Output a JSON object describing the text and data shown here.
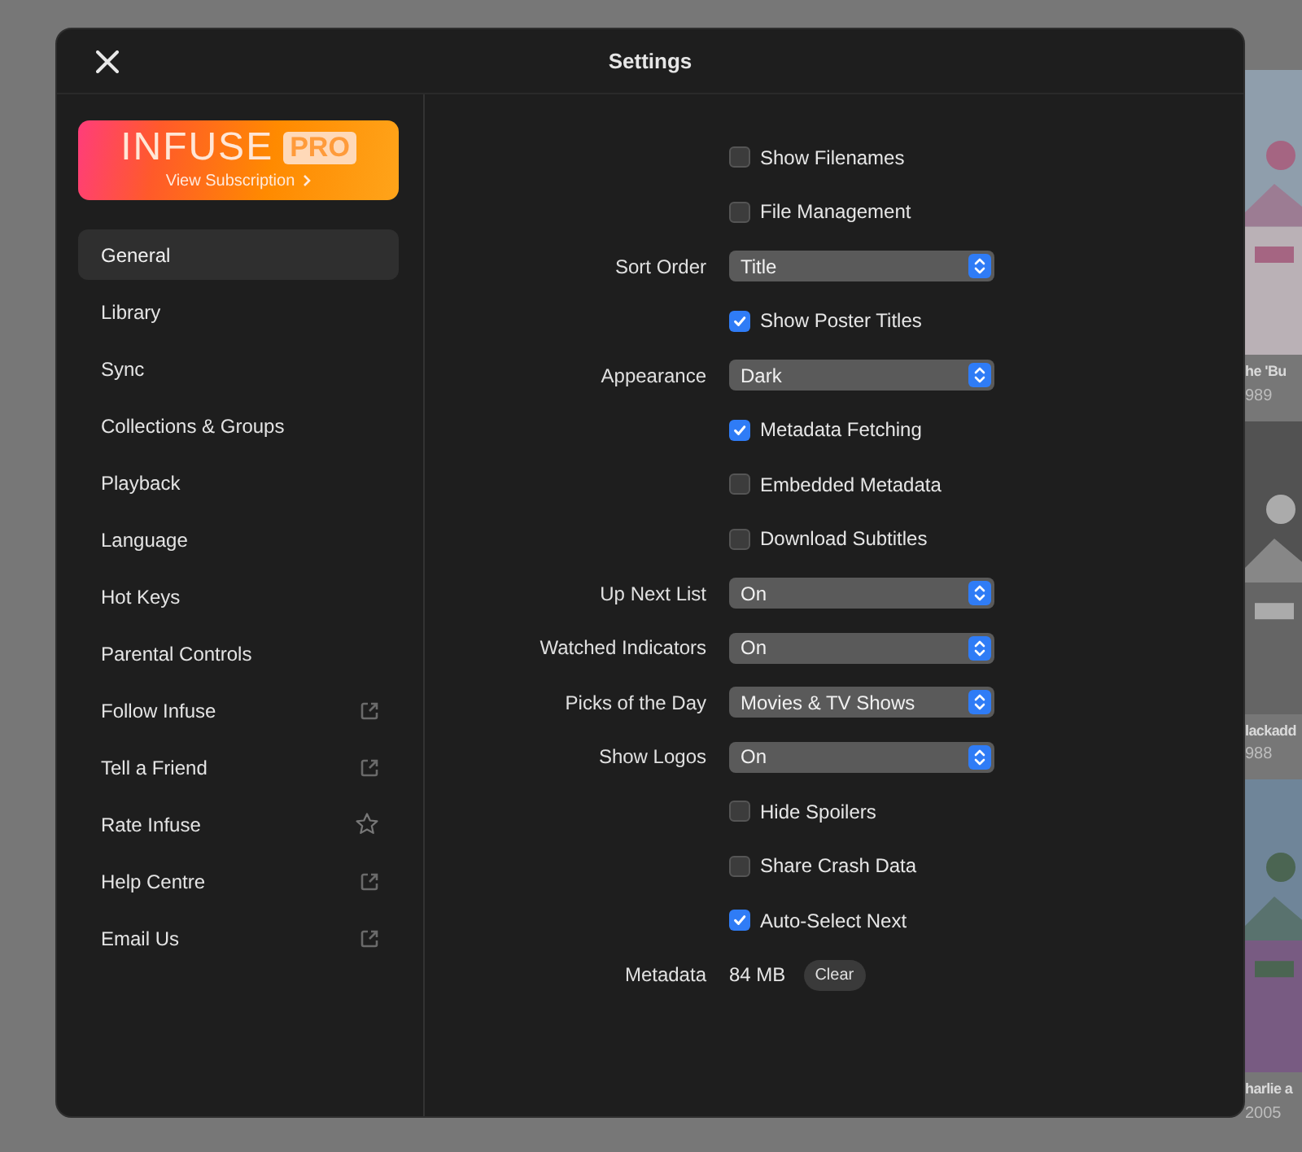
{
  "window": {
    "title": "Settings"
  },
  "banner": {
    "brand": "INFUSE",
    "tier": "PRO",
    "link": "View Subscription"
  },
  "sidebar": {
    "items": [
      {
        "label": "General",
        "selected": true
      },
      {
        "label": "Library",
        "selected": false
      },
      {
        "label": "Sync",
        "selected": false
      },
      {
        "label": "Collections & Groups",
        "selected": false
      },
      {
        "label": "Playback",
        "selected": false
      },
      {
        "label": "Language",
        "selected": false
      },
      {
        "label": "Hot Keys",
        "selected": false
      },
      {
        "label": "Parental Controls",
        "selected": false
      },
      {
        "label": "Follow Infuse",
        "selected": false,
        "kind": "external"
      },
      {
        "label": "Tell a Friend",
        "selected": false,
        "kind": "external"
      },
      {
        "label": "Rate Infuse",
        "selected": false,
        "kind": "star"
      },
      {
        "label": "Help Centre",
        "selected": false,
        "kind": "external"
      },
      {
        "label": "Email Us",
        "selected": false,
        "kind": "external"
      }
    ]
  },
  "settings": [
    {
      "kind": "checkbox",
      "label": "Show Filenames",
      "checked": false
    },
    {
      "kind": "checkbox",
      "label": "File Management",
      "checked": false
    },
    {
      "kind": "select",
      "label": "Sort Order",
      "value": "Title"
    },
    {
      "kind": "checkbox",
      "label": "Show Poster Titles",
      "checked": true
    },
    {
      "kind": "select",
      "label": "Appearance",
      "value": "Dark"
    },
    {
      "kind": "checkbox",
      "label": "Metadata Fetching",
      "checked": true
    },
    {
      "kind": "checkbox",
      "label": "Embedded Metadata",
      "checked": false
    },
    {
      "kind": "checkbox",
      "label": "Download Subtitles",
      "checked": false
    },
    {
      "kind": "select",
      "label": "Up Next List",
      "value": "On"
    },
    {
      "kind": "select",
      "label": "Watched Indicators",
      "value": "On"
    },
    {
      "kind": "select",
      "label": "Picks of the Day",
      "value": "Movies & TV Shows"
    },
    {
      "kind": "select",
      "label": "Show Logos",
      "value": "On"
    },
    {
      "kind": "checkbox",
      "label": "Hide Spoilers",
      "checked": false
    },
    {
      "kind": "checkbox",
      "label": "Share Crash Data",
      "checked": false
    },
    {
      "kind": "checkbox",
      "label": "Auto-Select Next",
      "checked": true
    },
    {
      "kind": "info",
      "label": "Metadata",
      "value": "84 MB",
      "button": "Clear"
    }
  ],
  "background": {
    "posters": [
      {
        "kind": "picture",
        "title": "he 'Bu",
        "year": "989"
      },
      {
        "kind": "picture",
        "title": "lackadd",
        "year": "988"
      },
      {
        "kind": "picture",
        "title": "harlie a",
        "year": "2005"
      }
    ]
  }
}
